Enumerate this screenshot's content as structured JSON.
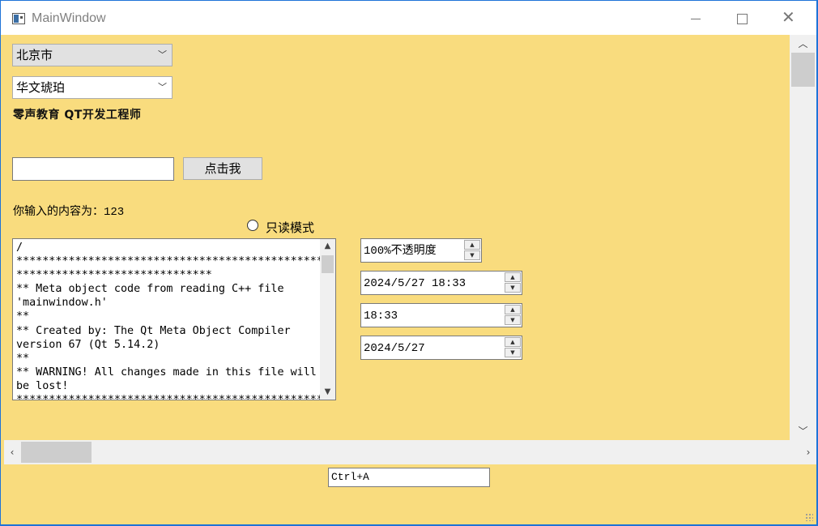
{
  "window": {
    "title": "MainWindow"
  },
  "city_combo": {
    "selected": "北京市"
  },
  "font_combo": {
    "selected": "华文琥珀"
  },
  "banner_label": "零声教育 QT开发工程师",
  "input": {
    "value": ""
  },
  "click_button": {
    "label": "点击我"
  },
  "echo_label": "你输入的内容为：123",
  "readonly_radio": {
    "label": "只读模式",
    "checked": false
  },
  "text_edit": {
    "content": "/\n***********************************************\n******************************\n** Meta object code from reading C++ file\n'mainwindow.h'\n**\n** Created by: The Qt Meta Object Compiler\nversion 67 (Qt 5.14.2)\n**\n** WARNING! All changes made in this file will\nbe lost!\n***********************************************"
  },
  "spin_opacity": {
    "value": "100%不透明度"
  },
  "datetime_edit": {
    "value": "2024/5/27 18:33"
  },
  "time_edit": {
    "value": "18:33"
  },
  "date_edit": {
    "value": "2024/5/27"
  },
  "key_sequence": {
    "value": "Ctrl+A"
  },
  "colors": {
    "background": "#f9dc7e",
    "frame": "#1e73d8"
  }
}
